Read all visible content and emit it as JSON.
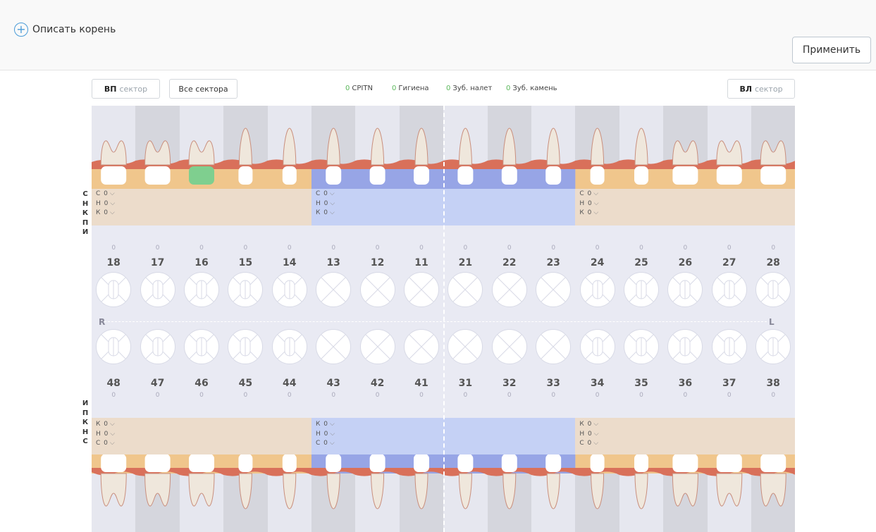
{
  "topbar": {
    "add_root_label": "Описать корень",
    "plus_glyph": "+",
    "apply_label": "Применить"
  },
  "controls": {
    "vp": {
      "bold": "ВП",
      "sub": "сектор"
    },
    "all": "Все сектора",
    "vl": {
      "bold": "ВЛ",
      "sub": "сектор"
    }
  },
  "stats": [
    {
      "value": "0",
      "label": "CPITN"
    },
    {
      "value": "0",
      "label": "Гигиена"
    },
    {
      "value": "0",
      "label": "Зуб. налет"
    },
    {
      "value": "0",
      "label": "Зуб. камень"
    }
  ],
  "row_labels_top": [
    "С",
    "Н",
    "К",
    "П",
    "И"
  ],
  "row_labels_bottom": [
    "И",
    "П",
    "К",
    "Н",
    "С"
  ],
  "levels_top": [
    "С 0",
    "Н 0",
    "К 0"
  ],
  "levels_bottom": [
    "К 0",
    "Н 0",
    "С 0"
  ],
  "side_labels": {
    "right": "R",
    "left": "L"
  },
  "upper_teeth": [
    "18",
    "17",
    "16",
    "15",
    "14",
    "13",
    "12",
    "11",
    "21",
    "22",
    "23",
    "24",
    "25",
    "26",
    "27",
    "28"
  ],
  "lower_teeth": [
    "48",
    "47",
    "46",
    "45",
    "44",
    "43",
    "42",
    "41",
    "31",
    "32",
    "33",
    "34",
    "35",
    "36",
    "37",
    "38"
  ],
  "upper_zero": "0",
  "lower_zero": "0",
  "colors": {
    "accent": "#4a9bd8",
    "green": "#5cb85c",
    "gum": "#d9705a",
    "bone_side": "#f0c68c",
    "bone_front": "#97a5e6",
    "band_side": "#ecdccb",
    "band_front": "#c5d1f5",
    "tooth": "#efe7dc",
    "crown_selected": "#7fcf8f"
  }
}
